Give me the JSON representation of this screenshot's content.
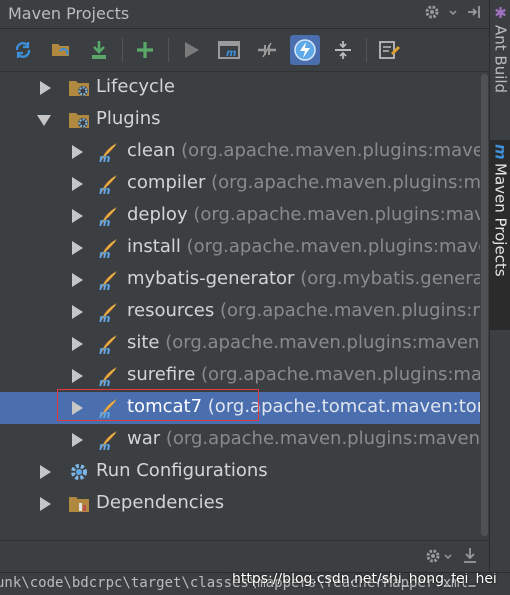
{
  "panel": {
    "title": "Maven Projects"
  },
  "title_icons": [
    "gear-icon",
    "chevron-down-icon",
    "hide-icon"
  ],
  "toolbar": [
    {
      "name": "reimport-icon",
      "color": "#3d8fd9"
    },
    {
      "name": "generate-sources-icon",
      "color": "#e0a030"
    },
    {
      "name": "download-icon",
      "color": "#59a869"
    },
    {
      "name": "add-icon",
      "color": "#59a869"
    },
    {
      "name": "run-icon",
      "color": "#7a7a7a"
    },
    {
      "name": "execute-goal-icon",
      "color": "#9a9a9a"
    },
    {
      "name": "toggle-offline-icon",
      "color": "#9a9a9a"
    },
    {
      "name": "skip-tests-icon",
      "color": "#3d8fd9"
    },
    {
      "name": "collapse-all-icon",
      "color": "#bbbbbb"
    },
    {
      "name": "settings-icon",
      "color": "#e0a030"
    }
  ],
  "tree": {
    "lifecycle": "Lifecycle",
    "plugins": "Plugins",
    "plugin_items": [
      {
        "name": "clean",
        "hint": "(org.apache.maven.plugins:maven-cl"
      },
      {
        "name": "compiler",
        "hint": "(org.apache.maven.plugins:maven"
      },
      {
        "name": "deploy",
        "hint": "(org.apache.maven.plugins:maven-"
      },
      {
        "name": "install",
        "hint": "(org.apache.maven.plugins:maven-i"
      },
      {
        "name": "mybatis-generator",
        "hint": "(org.mybatis.generator"
      },
      {
        "name": "resources",
        "hint": "(org.apache.maven.plugins:mave"
      },
      {
        "name": "site",
        "hint": "(org.apache.maven.plugins:maven-site-p"
      },
      {
        "name": "surefire",
        "hint": "(org.apache.maven.plugins:maven"
      },
      {
        "name": "tomcat7",
        "hint": "(org.apache.tomcat.maven:tomca"
      },
      {
        "name": "war",
        "hint": "(org.apache.maven.plugins:maven-wa"
      }
    ],
    "run_configurations": "Run Configurations",
    "dependencies": "Dependencies",
    "selected_item": "tomcat7"
  },
  "right_tabs": {
    "ant_build": "Ant Build",
    "maven_projects": "Maven Projects"
  },
  "status": {
    "path": "unk\\code\\bdcrpc\\target\\classes\\mappers\\TeacherMapper.xml",
    "watermark": "https://blog.csdn.net/shi_hong_fei_hei"
  },
  "colors": {
    "background": "#3c3f41",
    "selection": "#4b6eaf",
    "highlight_border": "#e03c3c"
  }
}
